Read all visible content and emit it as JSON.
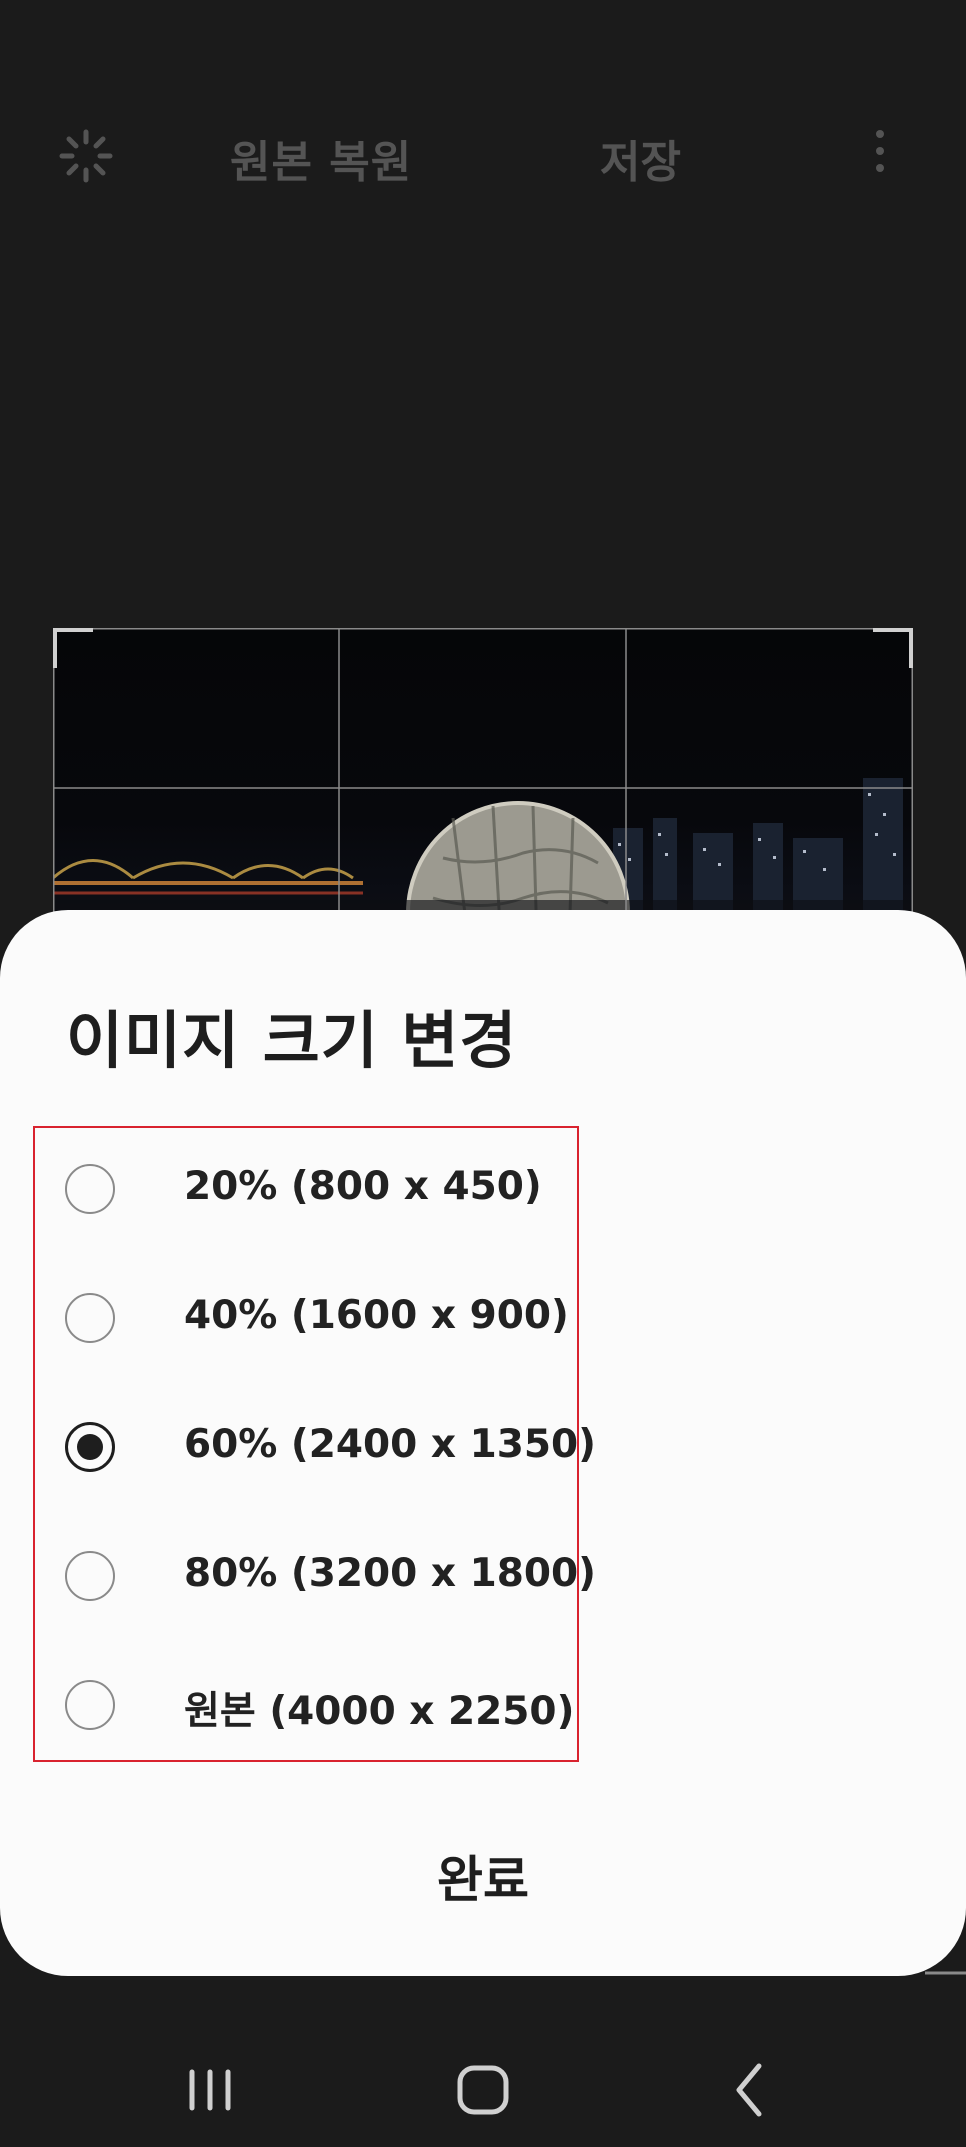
{
  "toolbar": {
    "revert_label": "원본 복원",
    "save_label": "저장"
  },
  "dialog": {
    "title": "이미지 크기 변경",
    "options": [
      {
        "label": "20% (800 x 450)",
        "checked": false
      },
      {
        "label": "40% (1600 x 900)",
        "checked": false
      },
      {
        "label": "60% (2400 x 1350)",
        "checked": true
      },
      {
        "label": "80% (3200 x 1800)",
        "checked": false
      },
      {
        "label": "원본 (4000 x 2250)",
        "checked": false
      }
    ],
    "done_label": "완료"
  },
  "icons": {
    "auto_adjust": "sparkle-icon",
    "more": "more-vertical-icon",
    "recents": "recent-apps-icon",
    "home": "home-icon",
    "back": "back-icon"
  },
  "colors": {
    "background": "#1b1b1b",
    "sheet": "#fbfbfb",
    "highlight_border": "#d9232f",
    "text": "#1e1e1e"
  }
}
